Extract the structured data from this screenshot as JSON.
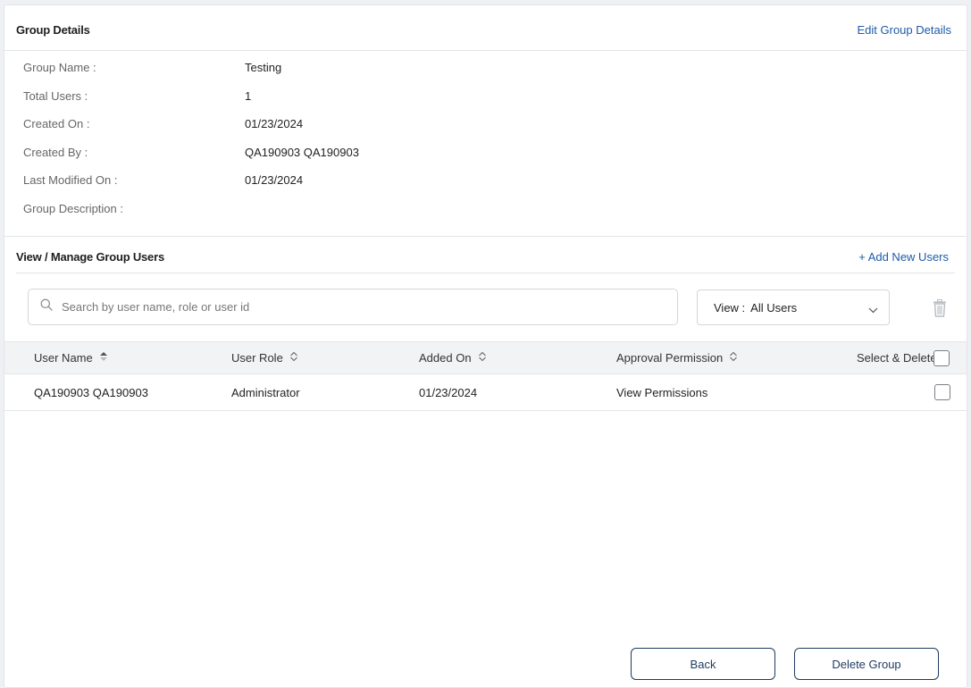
{
  "group_details": {
    "title": "Group Details",
    "edit_link": "Edit Group Details",
    "rows": [
      {
        "label": "Group Name :",
        "value": "Testing"
      },
      {
        "label": "Total Users :",
        "value": "1"
      },
      {
        "label": "Created On :",
        "value": "01/23/2024"
      },
      {
        "label": "Created By :",
        "value": "QA190903 QA190903"
      },
      {
        "label": "Last Modified On :",
        "value": "01/23/2024"
      },
      {
        "label": "Group Description :",
        "value": ""
      }
    ]
  },
  "manage_users": {
    "title": "View / Manage Group Users",
    "add_link": "+ Add New Users"
  },
  "search": {
    "placeholder": "Search by user name, role or user id",
    "value": ""
  },
  "view_filter": {
    "label": "View :",
    "selected": "All Users"
  },
  "table": {
    "columns": [
      "User Name",
      "User Role",
      "Added On",
      "Approval Permission",
      "Select & Delete"
    ],
    "rows": [
      {
        "user_name": "QA190903 QA190903",
        "user_role": "Administrator",
        "added_on": "01/23/2024",
        "permission_link": "View Permissions",
        "selected": false
      }
    ]
  },
  "footer": {
    "back_label": "Back",
    "delete_label": "Delete Group"
  },
  "colors": {
    "link": "#1d5ba8",
    "button_border": "#1f3a5f",
    "header_bg": "#f1f3f5"
  }
}
